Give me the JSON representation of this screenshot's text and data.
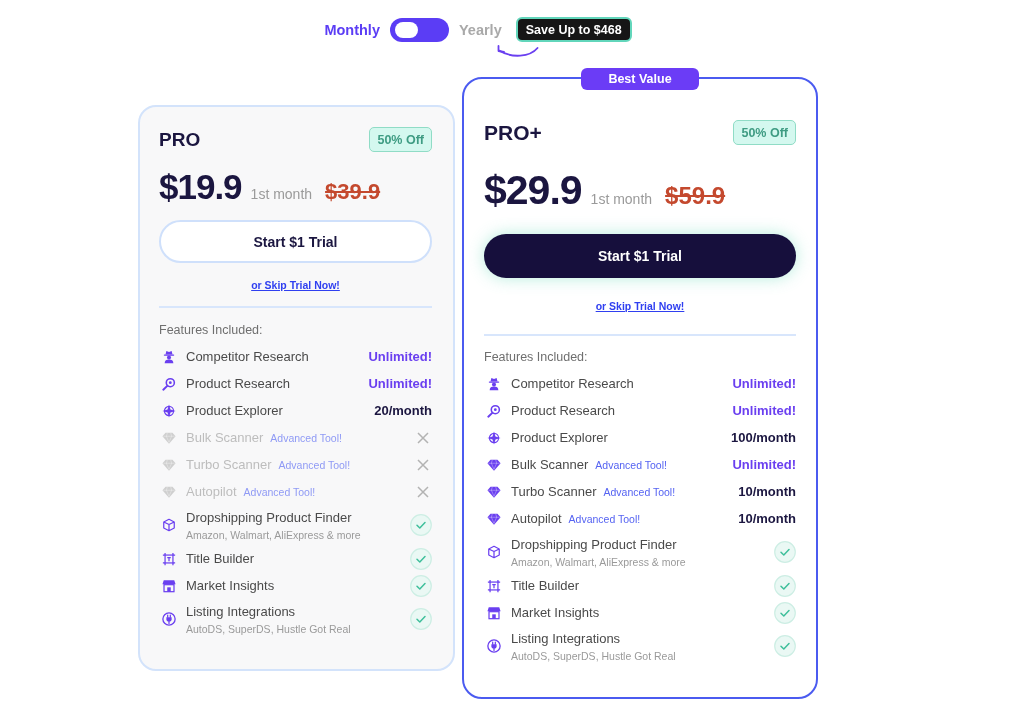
{
  "billing_toggle": {
    "options": [
      {
        "label": "Monthly",
        "selected": true
      },
      {
        "label": "Yearly",
        "selected": false
      }
    ],
    "savings_badge": "Save Up to $468"
  },
  "plans": [
    {
      "name": "PRO",
      "featured": false,
      "discount_badge": "50% Off",
      "price": "$19.9",
      "price_note": "1st month",
      "original_price": "$39.9",
      "cta": "Start $1 Trial",
      "skip_link": "or Skip Trial Now!",
      "features_heading": "Features Included:",
      "features": [
        {
          "kind": "value",
          "name": "Competitor Research",
          "value": "Unlimited!",
          "highlighted": true
        },
        {
          "kind": "value",
          "name": "Product Research",
          "value": "Unlimited!",
          "highlighted": true
        },
        {
          "kind": "value",
          "name": "Product Explorer",
          "value": "20/month",
          "highlighted": false
        },
        {
          "kind": "unavailable",
          "name": "Bulk Scanner",
          "tag": "Advanced Tool!"
        },
        {
          "kind": "unavailable",
          "name": "Turbo Scanner",
          "tag": "Advanced Tool!"
        },
        {
          "kind": "unavailable",
          "name": "Autopilot",
          "tag": "Advanced Tool!"
        },
        {
          "kind": "check",
          "name": "Dropshipping Product Finder",
          "description": "Amazon, Walmart, AliExpress & more"
        },
        {
          "kind": "check",
          "name": "Title Builder"
        },
        {
          "kind": "check",
          "name": "Market Insights"
        },
        {
          "kind": "check",
          "name": "Listing Integrations",
          "description": "AutoDS, SuperDS, Hustle Got Real"
        }
      ]
    },
    {
      "name": "PRO+",
      "featured": true,
      "ribbon": "Best Value",
      "discount_badge": "50% Off",
      "price": "$29.9",
      "price_note": "1st month",
      "original_price": "$59.9",
      "cta": "Start $1 Trial",
      "skip_link": "or Skip Trial Now!",
      "features_heading": "Features Included:",
      "features": [
        {
          "kind": "value",
          "name": "Competitor Research",
          "value": "Unlimited!",
          "highlighted": true
        },
        {
          "kind": "value",
          "name": "Product Research",
          "value": "Unlimited!",
          "highlighted": true
        },
        {
          "kind": "value",
          "name": "Product Explorer",
          "value": "100/month",
          "highlighted": false
        },
        {
          "kind": "value",
          "name": "Bulk Scanner",
          "tag": "Advanced Tool!",
          "value": "Unlimited!",
          "highlighted": true
        },
        {
          "kind": "value",
          "name": "Turbo Scanner",
          "tag": "Advanced Tool!",
          "value": "10/month",
          "highlighted": false
        },
        {
          "kind": "value",
          "name": "Autopilot",
          "tag": "Advanced Tool!",
          "value": "10/month",
          "highlighted": false
        },
        {
          "kind": "check",
          "name": "Dropshipping Product Finder",
          "description": "Amazon, Walmart, AliExpress & more"
        },
        {
          "kind": "check",
          "name": "Title Builder"
        },
        {
          "kind": "check",
          "name": "Market Insights"
        },
        {
          "kind": "check",
          "name": "Listing Integrations",
          "description": "AutoDS, SuperDS, Hustle Got Real"
        }
      ]
    }
  ]
}
